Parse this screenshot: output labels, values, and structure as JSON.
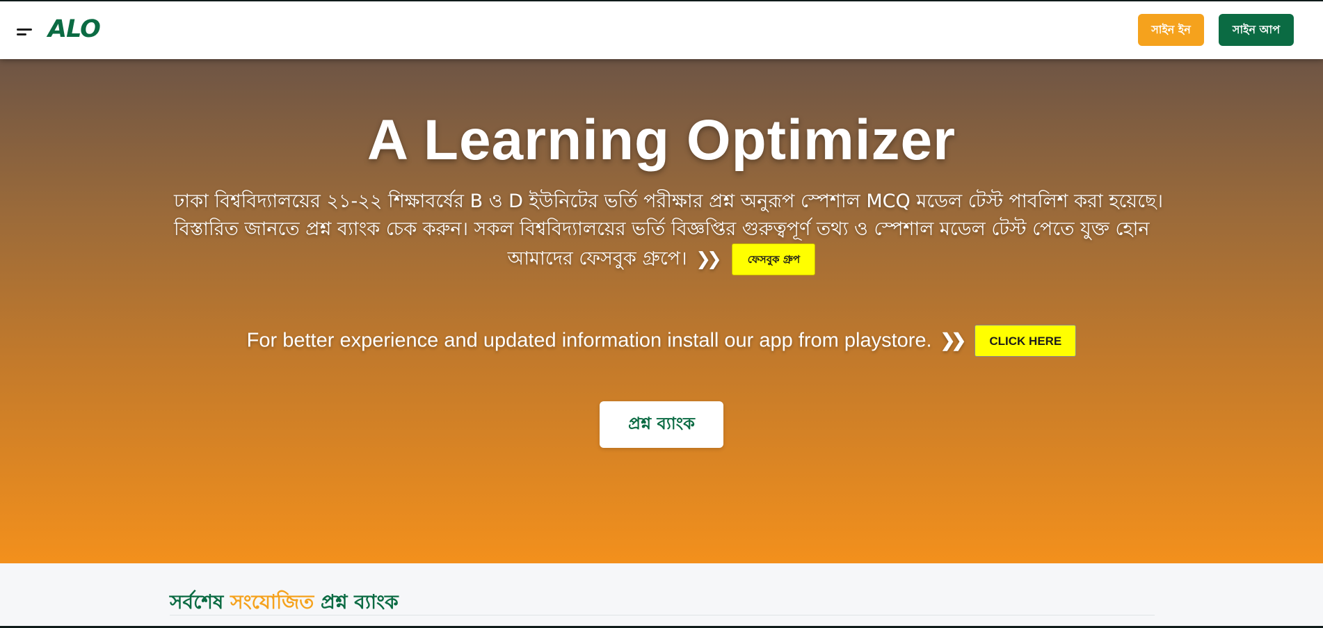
{
  "header": {
    "logo": "ALO",
    "signin_label": "সাইন ইন",
    "signup_label": "সাইন আপ",
    "colors": {
      "brand_green": "#0b6b43",
      "brand_orange": "#f5a21d"
    }
  },
  "hero": {
    "title": "A Learning Optimizer",
    "desc_line1": "ঢাকা বিশ্ববিদ্যালয়ের ২১-২২ শিক্ষাবর্ষের B ও D ইউনিটের ভর্তি পরীক্ষার প্রশ্ন অনুরূপ স্পেশাল MCQ মডেল টেস্ট পাবলিশ করা হয়েছে।",
    "desc_line2": "বিস্তারিত জানতে প্রশ্ন ব্যাংক চেক করুন। সকল বিশ্ববিদ্যালয়ের ভর্তি বিজ্ঞপ্তির গুরুত্বপূর্ণ তথ্য ও স্পেশাল মডেল টেস্ট পেতে যুক্ত হোন",
    "desc_line3": "আমাদের ফেসবুক গ্রুপে।",
    "facebook_button": "ফেসবুক গ্রুপ",
    "app_text": "For better experience and updated information install our app from playstore.",
    "click_here": "CLICK HERE",
    "question_bank_button": "প্রশ্ন ব্যাংক",
    "icons": [
      "menu-icon",
      "double-chevron-right-icon"
    ]
  },
  "latest": {
    "heading_part1": "সর্বশেষ",
    "heading_part2": "সংযোজিত",
    "heading_part3": "প্রশ্ন ব্যাংক"
  }
}
